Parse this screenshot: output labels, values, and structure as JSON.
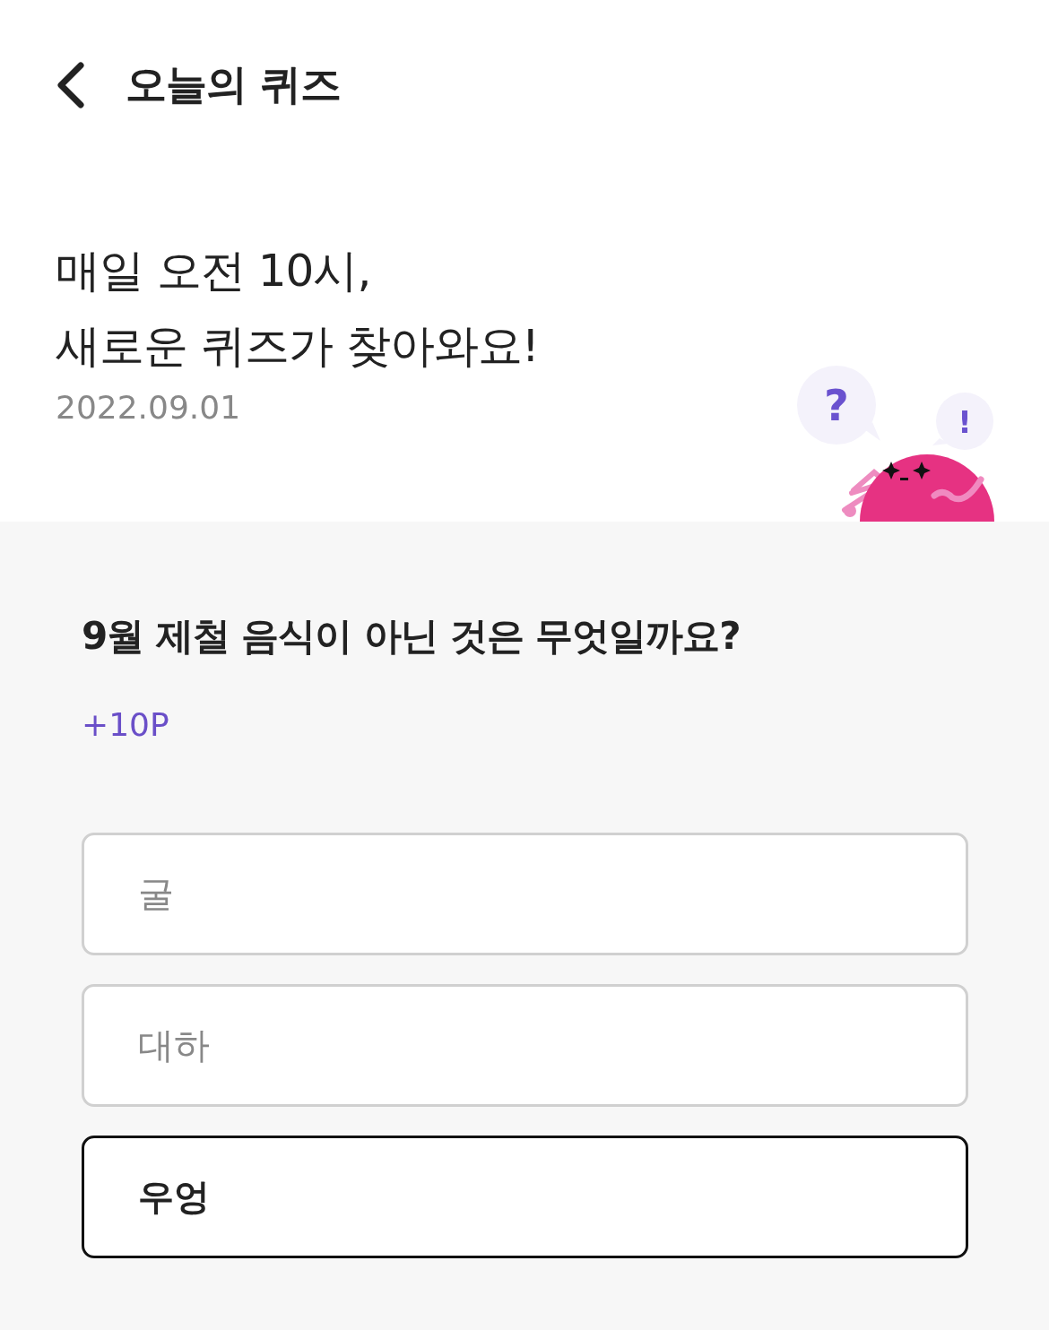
{
  "header": {
    "title": "오늘의 퀴즈"
  },
  "intro": {
    "lines": [
      "매일 오전 10시,",
      "새로운 퀴즈가 찾아와요!"
    ],
    "date": "2022.09.01",
    "bubbles": [
      "?",
      "!"
    ]
  },
  "quiz": {
    "question": "9월 제철 음식이 아닌 것은 무엇일까요?",
    "reward": "+10P",
    "options": [
      {
        "label": "굴",
        "selected": false
      },
      {
        "label": "대하",
        "selected": false
      },
      {
        "label": "우엉",
        "selected": true
      }
    ]
  }
}
